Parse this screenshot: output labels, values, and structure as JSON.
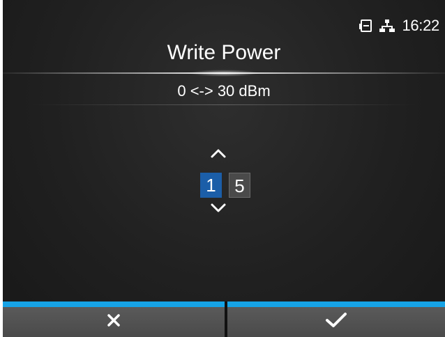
{
  "status": {
    "time": "16:22",
    "icons": [
      "storage-card-icon",
      "network-icon"
    ]
  },
  "title": "Write Power",
  "range": "0 <-> 30 dBm",
  "spinner": {
    "digits": [
      "1",
      "5"
    ],
    "selected_index": 0
  },
  "buttons": {
    "cancel_icon": "close-icon",
    "confirm_icon": "checkmark-icon"
  },
  "colors": {
    "accent_bar": "#16a3e6",
    "selected_digit": "#1b5ea8",
    "background": "#202020"
  }
}
